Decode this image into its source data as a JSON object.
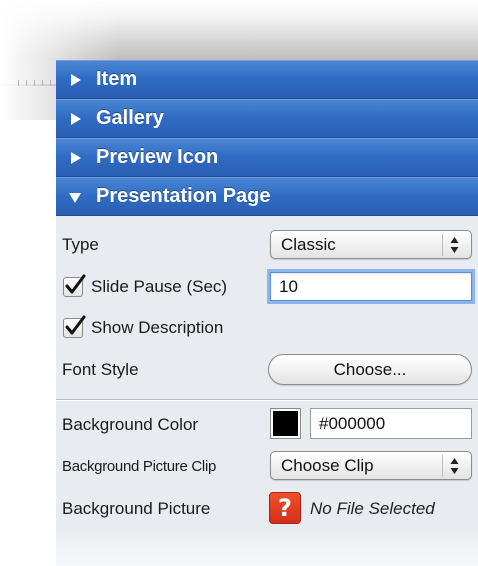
{
  "sections": [
    {
      "label": "Item",
      "expanded": false
    },
    {
      "label": "Gallery",
      "expanded": false
    },
    {
      "label": "Preview Icon",
      "expanded": false
    },
    {
      "label": "Presentation Page",
      "expanded": true
    }
  ],
  "presentation": {
    "type_label": "Type",
    "type_value": "Classic",
    "slide_pause_label": "Slide Pause (Sec)",
    "slide_pause_checked": true,
    "slide_pause_value": "10",
    "show_description_label": "Show Description",
    "show_description_checked": true,
    "font_style_label": "Font Style",
    "font_style_button": "Choose...",
    "bg_color_label": "Background Color",
    "bg_color_value": "#000000",
    "bg_color_swatch": "#000000",
    "bg_clip_label": "Background Picture Clip",
    "bg_clip_value": "Choose Clip",
    "bg_picture_label": "Background Picture",
    "bg_picture_icon": "question-mark-icon",
    "bg_picture_status": "No File Selected"
  },
  "colors": {
    "header_blue": "#2f6bc2",
    "panel_bg": "#e8ebf0",
    "missing_icon": "#e0401f"
  }
}
